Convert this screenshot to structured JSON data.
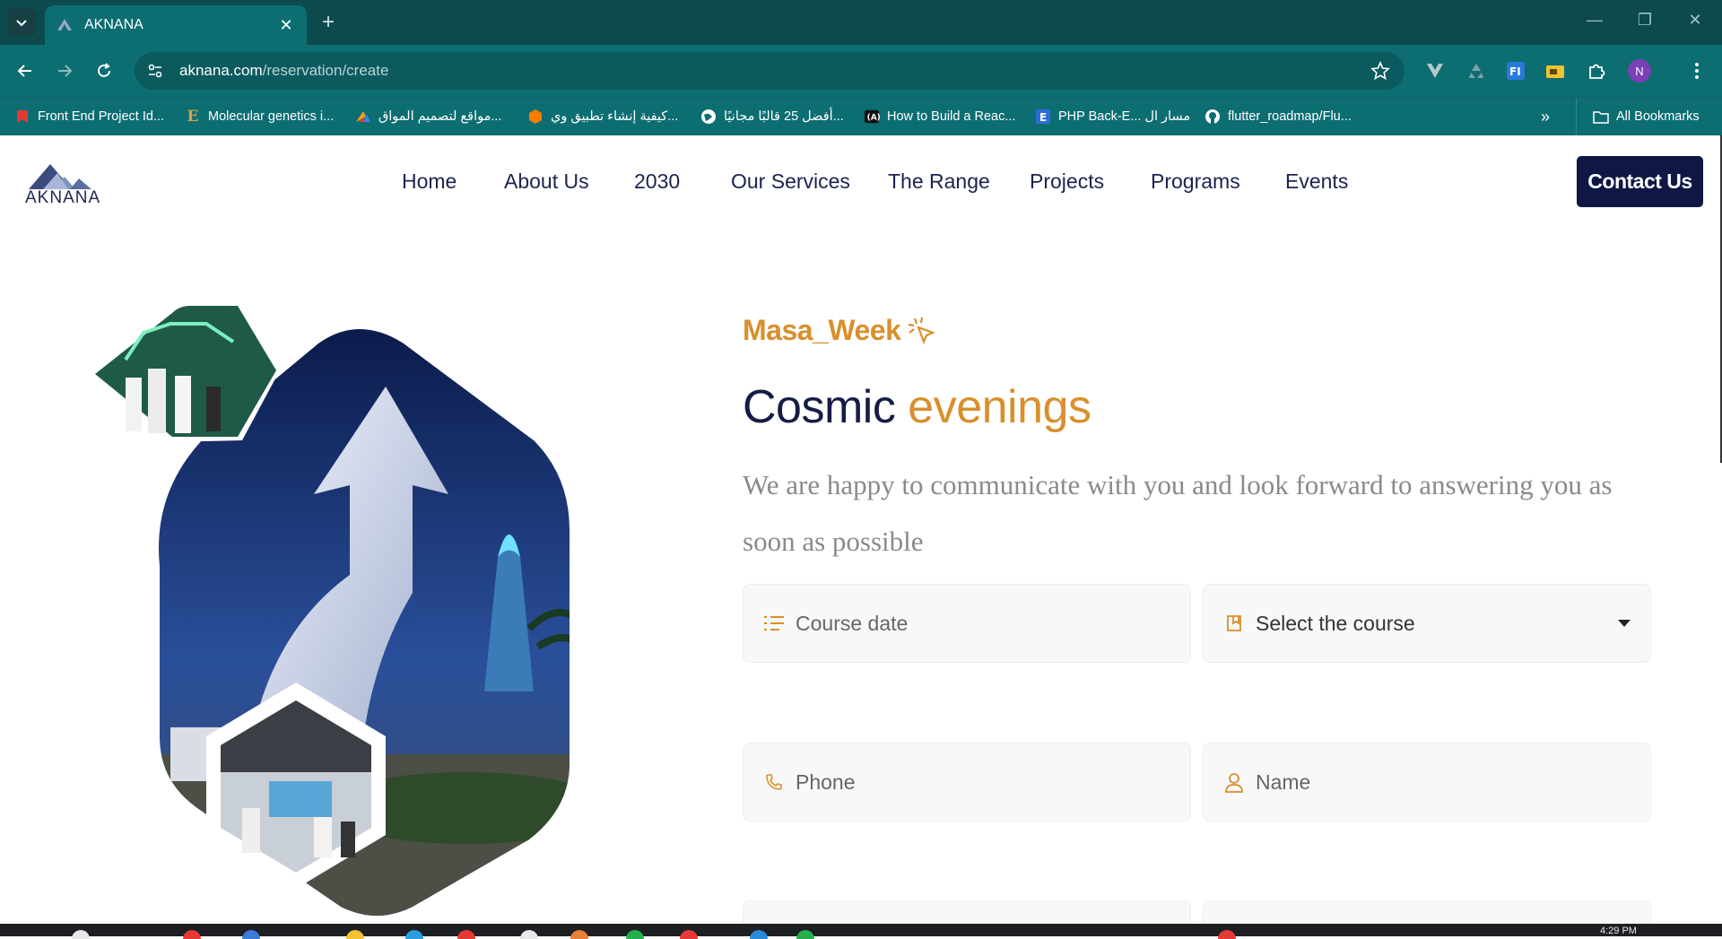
{
  "browser": {
    "tab_title": "AKNANA",
    "url_domain": "aknana.com",
    "url_path": "/reservation/create",
    "profile_initial": "N",
    "bookmarks": [
      {
        "label": "Front End Project Id...",
        "icon": "red-bookmark-icon",
        "color": "#e53935"
      },
      {
        "label": "Molecular genetics i...",
        "icon": "e-letter-icon",
        "color": "#d2a24c"
      },
      {
        "label": "مواقع لتصميم المواق...",
        "icon": "multicolor-icon",
        "color": "#f0a020"
      },
      {
        "label": "كيفية إنشاء تطبيق وي...",
        "icon": "orange-cube-icon",
        "color": "#f57c00"
      },
      {
        "label": "أفضل 25 قالبًا مجانيًا...",
        "icon": "globe-icon",
        "color": "#ffffff"
      },
      {
        "label": "How to Build a Reac...",
        "icon": "react-icon",
        "color": "#ffffff"
      },
      {
        "label": "PHP Back-E... مسار ال",
        "icon": "e-square-icon",
        "color": "#2f6bd8"
      },
      {
        "label": "flutter_roadmap/Flu...",
        "icon": "github-icon",
        "color": "#ffffff"
      }
    ],
    "all_bookmarks": "All Bookmarks"
  },
  "site": {
    "logo_text": "AKNANA",
    "nav": [
      "Home",
      "About Us",
      "2030",
      "Our Services",
      "The Range",
      "Projects",
      "Programs",
      "Events"
    ],
    "contact_label": "Contact Us"
  },
  "hero": {
    "eyebrow": "Masa_Week",
    "headline_main": "Cosmic",
    "headline_accent": "evenings",
    "lead": "We are happy to communicate with you and look forward to answering you as soon as possible",
    "fields": {
      "course_date": "Course date",
      "course_select": "Select the course",
      "phone": "Phone",
      "name": "Name"
    }
  },
  "taskbar": {
    "time": "4:29 PM"
  },
  "colors": {
    "brand_navy": "#0f1744",
    "accent_orange": "#d98f2b",
    "chrome_teal": "#0d6e72"
  }
}
